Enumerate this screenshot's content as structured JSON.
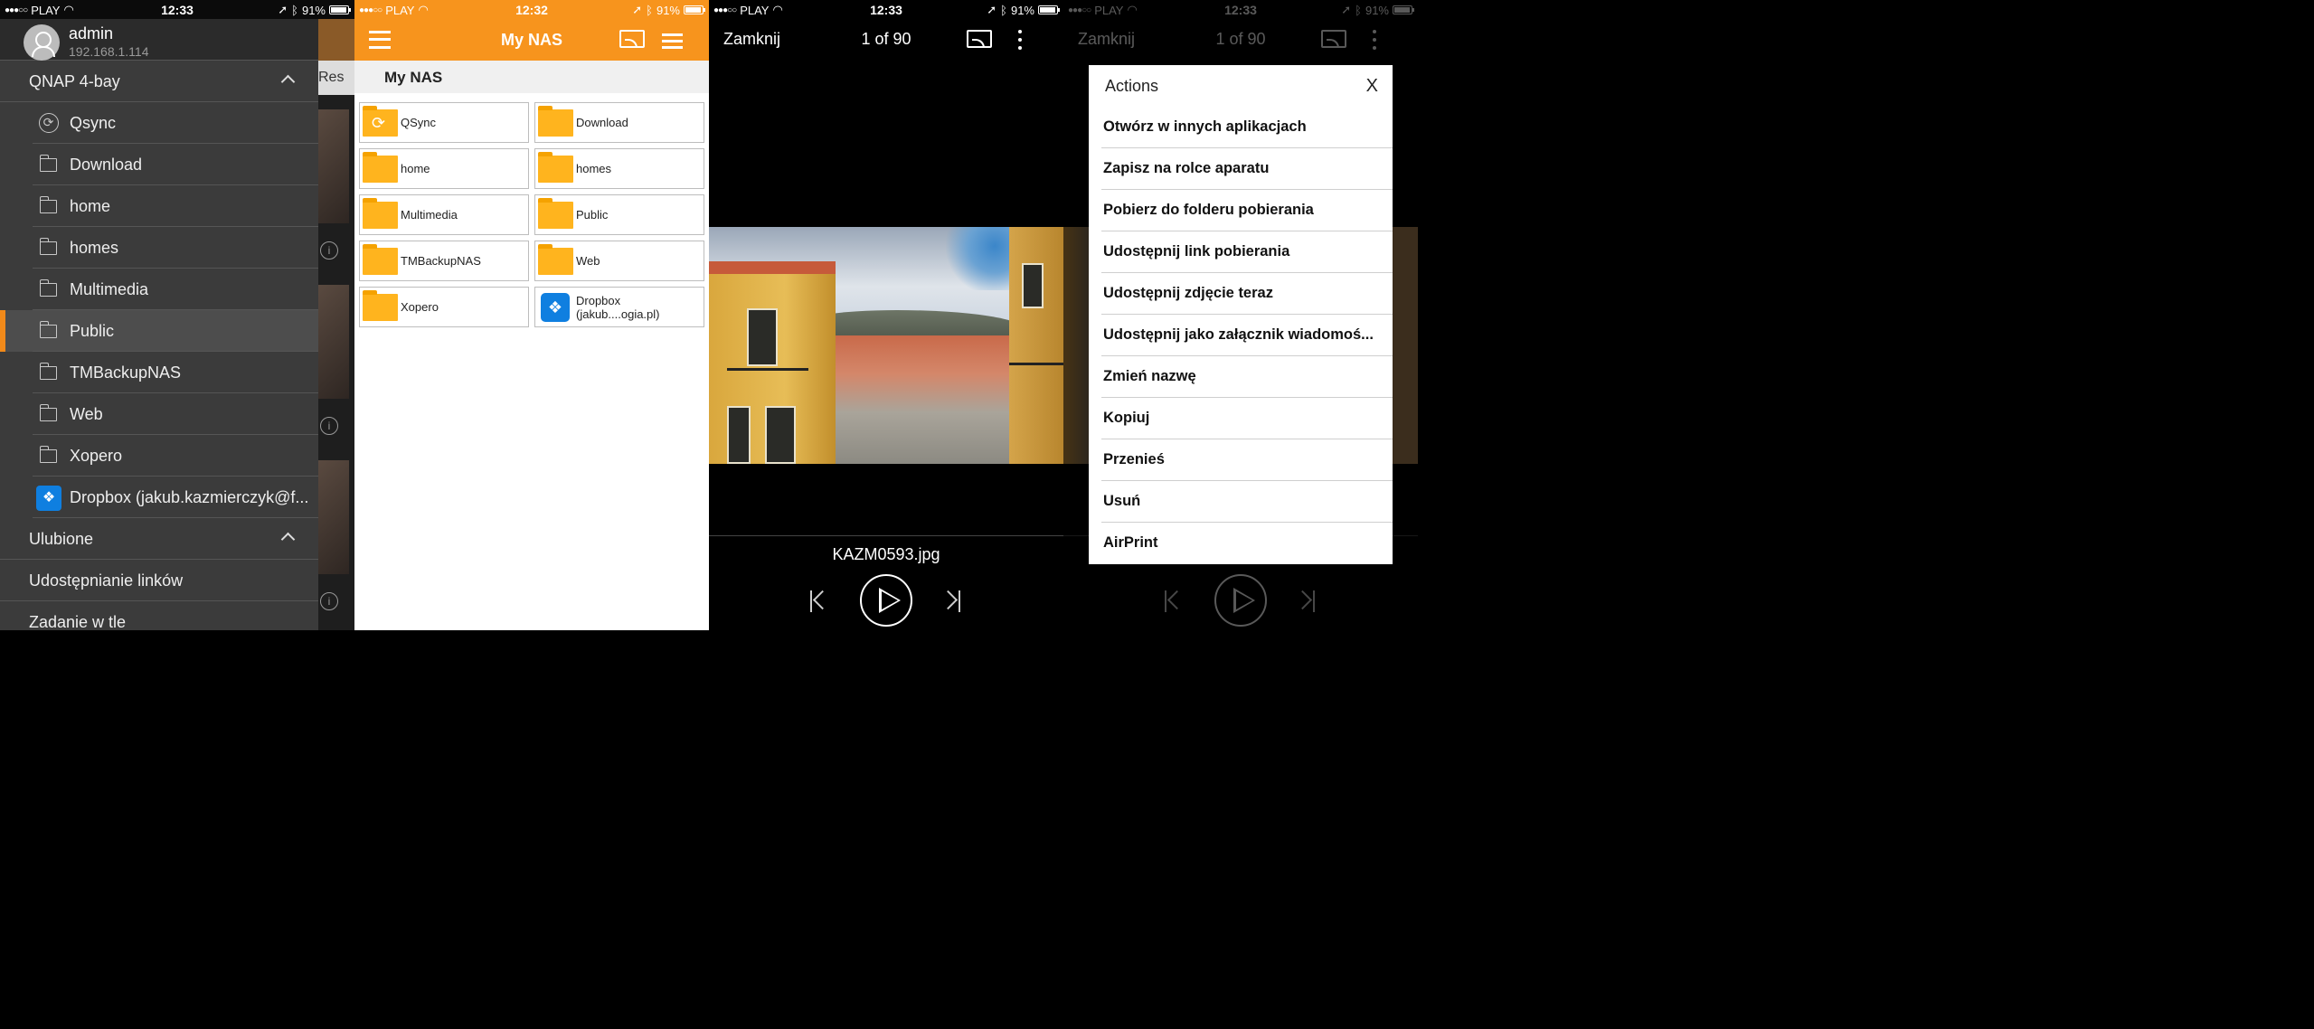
{
  "status": {
    "carrier": "PLAY",
    "time_p1": "12:33",
    "time_p2": "12:32",
    "time_p3": "12:33",
    "time_p4": "12:33",
    "battery": "91%"
  },
  "drawer": {
    "user": {
      "name": "admin",
      "ip": "192.168.1.114"
    },
    "nas_section": "QNAP 4-bay",
    "items": [
      {
        "label": "Qsync",
        "icon": "sync-icon"
      },
      {
        "label": "Download",
        "icon": "folder-icon"
      },
      {
        "label": "home",
        "icon": "folder-icon"
      },
      {
        "label": "homes",
        "icon": "folder-icon"
      },
      {
        "label": "Multimedia",
        "icon": "folder-icon"
      },
      {
        "label": "Public",
        "icon": "folder-icon",
        "active": true
      },
      {
        "label": "TMBackupNAS",
        "icon": "folder-icon"
      },
      {
        "label": "Web",
        "icon": "folder-icon"
      },
      {
        "label": "Xopero",
        "icon": "folder-icon"
      },
      {
        "label": "Dropbox (jakub.kazmierczyk@f...",
        "icon": "dropbox-icon"
      }
    ],
    "favorites_section": "Ulubione",
    "extra": [
      "Udostępnianie linków",
      "Zadanie w tle"
    ],
    "behind_text": "Res"
  },
  "browser": {
    "title": "My NAS",
    "breadcrumb": "My NAS",
    "tiles": [
      {
        "label": "QSync",
        "icon": "sync-folder-icon"
      },
      {
        "label": "Download",
        "icon": "folder-icon"
      },
      {
        "label": "home",
        "icon": "folder-icon"
      },
      {
        "label": "homes",
        "icon": "folder-icon"
      },
      {
        "label": "Multimedia",
        "icon": "folder-icon"
      },
      {
        "label": "Public",
        "icon": "folder-icon"
      },
      {
        "label": "TMBackupNAS",
        "icon": "folder-icon"
      },
      {
        "label": "Web",
        "icon": "folder-icon"
      },
      {
        "label": "Xopero",
        "icon": "folder-icon"
      },
      {
        "label": "Dropbox (jakub....ogia.pl)",
        "icon": "dropbox-icon"
      }
    ]
  },
  "viewer": {
    "close_label": "Zamknij",
    "counter": "1 of 90",
    "filename": "KAZM0593.jpg"
  },
  "actions": {
    "title": "Actions",
    "close": "X",
    "items": [
      "Otwórz w innych aplikacjach",
      "Zapisz na rolce aparatu",
      "Pobierz do folderu pobierania",
      "Udostępnij link pobierania",
      "Udostępnij zdjęcie teraz",
      "Udostępnij jako załącznik wiadomoś...",
      "Zmień nazwę",
      "Kopiuj",
      "Przenieś",
      "Usuń",
      "AirPrint"
    ]
  },
  "colors": {
    "accent": "#f7941d",
    "dropbox": "#0f7fe0",
    "folder": "#ffb41e"
  }
}
